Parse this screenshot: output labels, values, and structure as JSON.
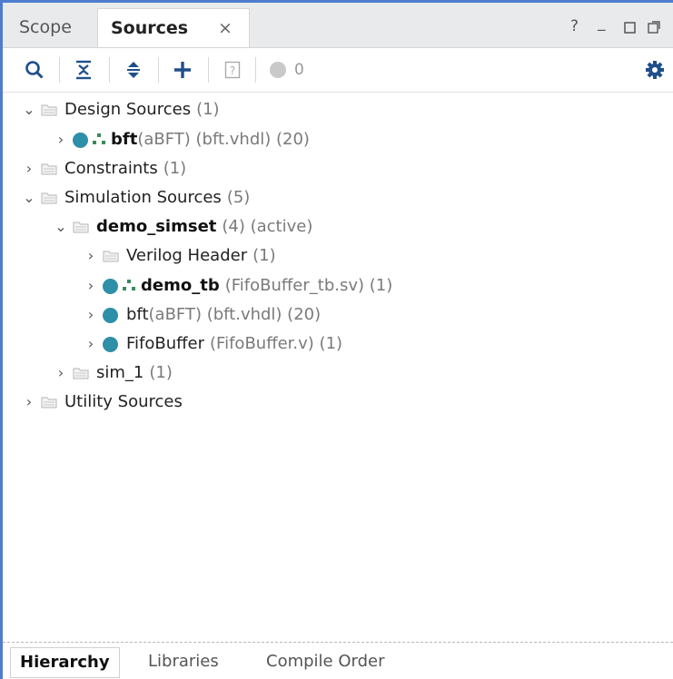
{
  "tabs": {
    "scope": "Scope",
    "sources": "Sources",
    "close": "×"
  },
  "window_controls": {
    "help": "?",
    "minimize": "_"
  },
  "toolbar": {
    "error_count": "0",
    "icons": [
      "search-icon",
      "collapse-all-icon",
      "expand-all-icon",
      "add-icon",
      "properties-icon",
      "status-dot-icon",
      "gear-icon"
    ]
  },
  "tree": {
    "design_sources": {
      "label": "Design Sources",
      "count": "(1)"
    },
    "bft_top": {
      "name": "bft",
      "detail": "(aBFT) (bft.vhdl) (20)"
    },
    "constraints": {
      "label": "Constraints",
      "count": "(1)"
    },
    "simulation_sources": {
      "label": "Simulation Sources",
      "count": "(5)"
    },
    "demo_simset": {
      "name": "demo_simset",
      "detail": "(4) (active)"
    },
    "verilog_header": {
      "label": "Verilog Header",
      "count": "(1)"
    },
    "demo_tb": {
      "name": "demo_tb",
      "detail": "(FifoBuffer_tb.sv) (1)"
    },
    "bft_sim": {
      "name": "bft",
      "detail": "(aBFT) (bft.vhdl) (20)"
    },
    "fifobuffer": {
      "name": "FifoBuffer",
      "detail": "(FifoBuffer.v) (1)"
    },
    "sim_1": {
      "label": "sim_1",
      "count": "(1)"
    },
    "utility_sources": {
      "label": "Utility Sources"
    }
  },
  "bottom_tabs": {
    "hierarchy": "Hierarchy",
    "libraries": "Libraries",
    "compile_order": "Compile Order"
  },
  "colors": {
    "accent": "#4f7ccd",
    "status_dot": "#2e8fa8",
    "tab_bar": "#e8eaec"
  }
}
